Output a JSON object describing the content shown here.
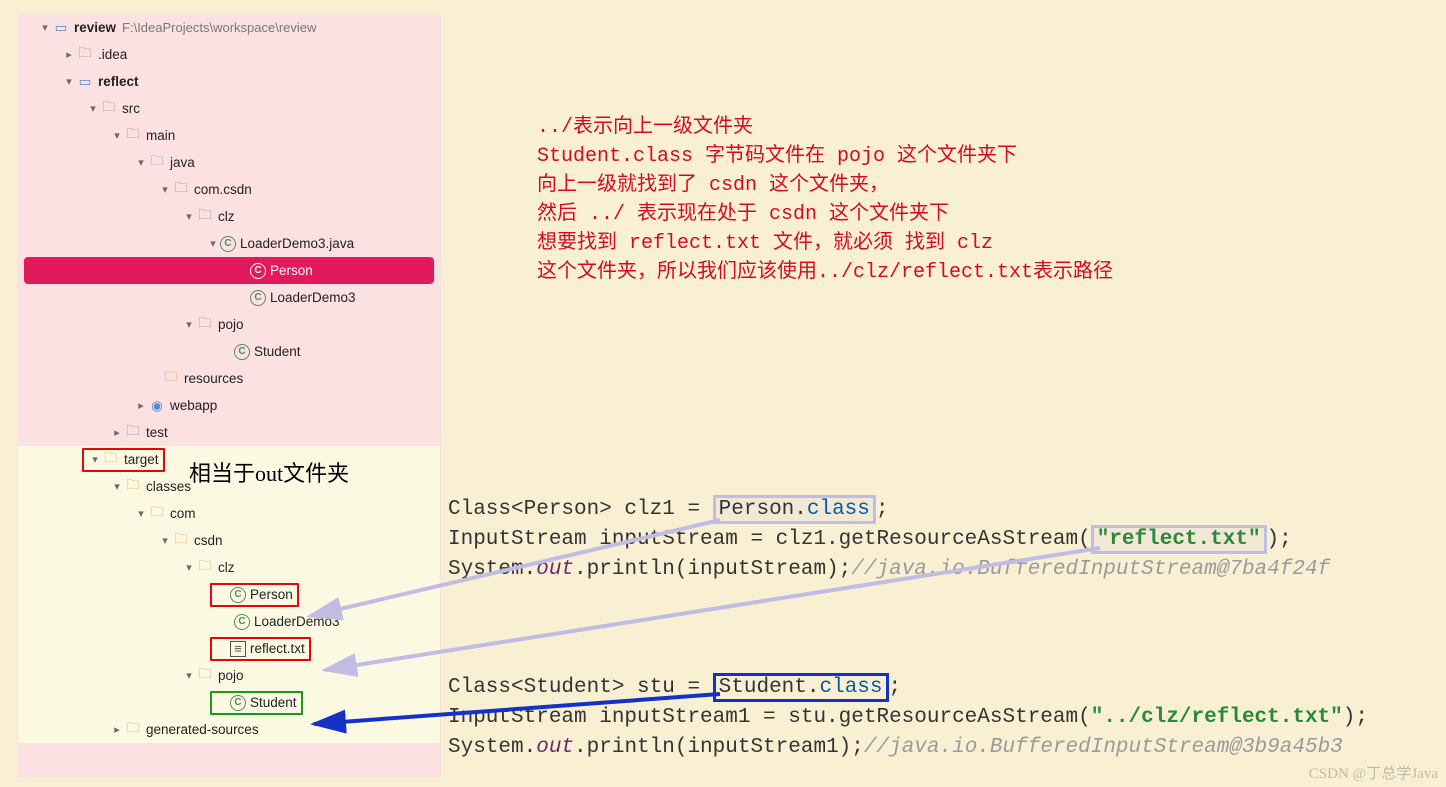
{
  "tree": {
    "root": {
      "name": "review",
      "path": "F:\\IdeaProjects\\workspace\\review"
    },
    "items": [
      {
        "label": ".idea"
      },
      {
        "label": "reflect"
      },
      {
        "label": "src"
      },
      {
        "label": "main"
      },
      {
        "label": "java"
      },
      {
        "label": "com.csdn"
      },
      {
        "label": "clz"
      },
      {
        "label": "LoaderDemo3.java"
      },
      {
        "label": "Person"
      },
      {
        "label": "LoaderDemo3"
      },
      {
        "label": "pojo"
      },
      {
        "label": "Student"
      },
      {
        "label": "resources"
      },
      {
        "label": "webapp"
      },
      {
        "label": "test"
      },
      {
        "label": "target"
      },
      {
        "label": "classes"
      },
      {
        "label": "com"
      },
      {
        "label": "csdn"
      },
      {
        "label": "clz"
      },
      {
        "label": "Person"
      },
      {
        "label": "LoaderDemo3"
      },
      {
        "label": "reflect.txt"
      },
      {
        "label": "pojo"
      },
      {
        "label": "Student"
      },
      {
        "label": "generated-sources"
      }
    ]
  },
  "annot": {
    "target_note": "相当于out文件夹"
  },
  "note": {
    "l1": "../表示向上一级文件夹",
    "l2": "Student.class 字节码文件在 pojo 这个文件夹下",
    "l3": "向上一级就找到了 csdn 这个文件夹，",
    "l4": "然后 ../ 表示现在处于 csdn 这个文件夹下",
    "l5": "想要找到 reflect.txt 文件，就必须 找到 clz",
    "l6": "这个文件夹，所以我们应该使用../clz/reflect.txt表示路径"
  },
  "code1": {
    "line1_pre": "Class<Person> clz1 = ",
    "line1_hl_a": "Person.",
    "line1_hl_kw": "class",
    "line1_post": ";",
    "line2_pre": "InputStream inputStream = clz1.getResourceAsStream(",
    "line2_str": "\"reflect.txt\"",
    "line2_post": ");",
    "line3_pre": "System.",
    "line3_field": "out",
    "line3_mid": ".println(inputStream);",
    "line3_cmt": "//java.io.BufferedInputStream@7ba4f24f"
  },
  "code2": {
    "line1_pre": "Class<Student> stu = ",
    "line1_hl_a": "Student.",
    "line1_hl_kw": "class",
    "line1_post": ";",
    "line2_pre": "InputStream inputStream1 = stu.getResourceAsStream(",
    "line2_str": "\"../clz/reflect.txt\"",
    "line2_post": ");",
    "line3_pre": "System.",
    "line3_field": "out",
    "line3_mid": ".println(inputStream1);",
    "line3_cmt": "//java.io.BufferedInputStream@3b9a45b3"
  },
  "watermark": "CSDN @丁总学Java"
}
